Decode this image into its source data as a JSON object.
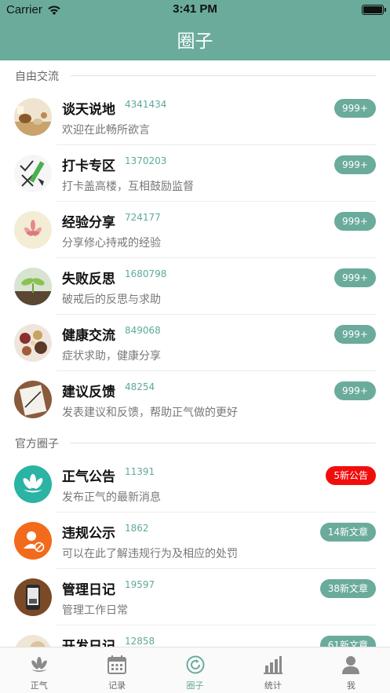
{
  "status_bar": {
    "carrier": "Carrier",
    "time": "3:41 PM"
  },
  "nav": {
    "title": "圈子"
  },
  "sections": [
    {
      "title": "自由交流"
    },
    {
      "title": "官方圈子"
    }
  ],
  "groups": [
    {
      "title": "谈天说地",
      "count": "4341434",
      "desc": "欢迎在此畅所欲言",
      "badge": "999+",
      "avatar": "tea-set-avatar"
    },
    {
      "title": "打卡专区",
      "count": "1370203",
      "desc": "打卡盖高楼，互相鼓励监督",
      "badge": "999+",
      "avatar": "checklist-avatar"
    },
    {
      "title": "经验分享",
      "count": "724177",
      "desc": "分享修心持戒的经验",
      "badge": "999+",
      "avatar": "lotus-painting-avatar"
    },
    {
      "title": "失败反思",
      "count": "1680798",
      "desc": "破戒后的反思与求助",
      "badge": "999+",
      "avatar": "sprout-avatar"
    },
    {
      "title": "健康交流",
      "count": "849068",
      "desc": "症状求助，健康分享",
      "badge": "999+",
      "avatar": "herbs-avatar"
    },
    {
      "title": "建议反馈",
      "count": "48254",
      "desc": "发表建议和反馈，帮助正气做的更好",
      "badge": "999+",
      "avatar": "notebook-avatar"
    },
    {
      "title": "正气公告",
      "count": "11391",
      "desc": "发布正气的最新消息",
      "badge": "5新公告",
      "avatar": "lotus-logo-avatar"
    },
    {
      "title": "违规公示",
      "count": "1862",
      "desc": "可以在此了解违规行为及相应的处罚",
      "badge": "14新文章",
      "avatar": "user-banned-avatar"
    },
    {
      "title": "管理日记",
      "count": "19597",
      "desc": "管理工作日常",
      "badge": "38新文章",
      "avatar": "phone-avatar"
    },
    {
      "title": "开发日记",
      "count": "12858",
      "desc": "",
      "badge": "61新文章",
      "avatar": "dev-avatar"
    }
  ],
  "colors": {
    "accent": "#6aab9c",
    "alert": "#f20d0d"
  },
  "tabs": [
    {
      "label": "正气",
      "icon": "lotus-icon"
    },
    {
      "label": "记录",
      "icon": "calendar-icon"
    },
    {
      "label": "圈子",
      "icon": "circle-refresh-icon",
      "active": true
    },
    {
      "label": "统计",
      "icon": "bar-chart-icon"
    },
    {
      "label": "我",
      "icon": "person-icon"
    }
  ]
}
